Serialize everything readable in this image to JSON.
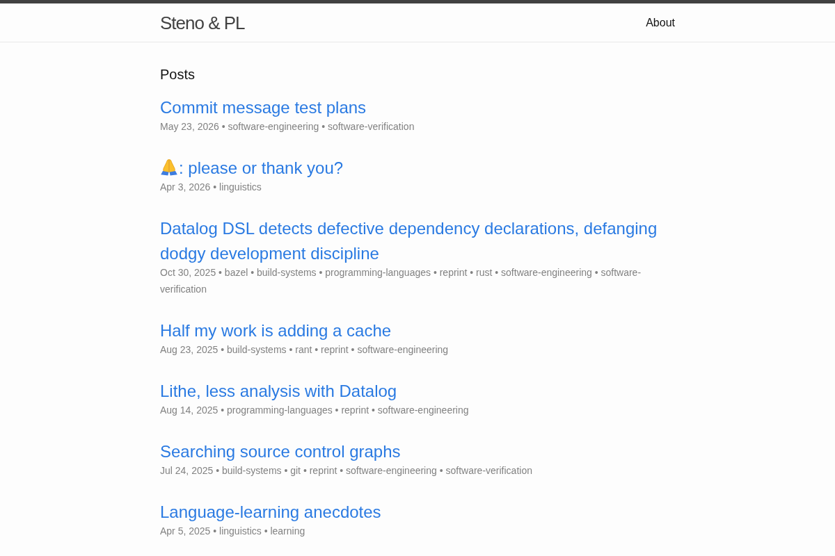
{
  "site": {
    "title": "Steno & PL",
    "nav": [
      {
        "label": "About"
      }
    ]
  },
  "heading": "Posts",
  "posts": [
    {
      "kind": "plain",
      "title": "Commit message test plans",
      "meta": "May 23, 2026 • software-engineering • software-verification"
    },
    {
      "kind": "with-icon",
      "title": ": please or thank you?",
      "meta": "Apr 3, 2026 • linguistics"
    },
    {
      "kind": "plain",
      "title": "Datalog DSL detects defective dependency declarations, defanging dodgy development discipline",
      "meta": "Oct 30, 2025 • bazel • build-systems • programming-languages • reprint • rust • software-engineering • software-verification"
    },
    {
      "kind": "plain",
      "title": "Half my work is adding a cache",
      "meta": "Aug 23, 2025 • build-systems • rant • reprint • software-engineering"
    },
    {
      "kind": "plain",
      "title": "Lithe, less analysis with Datalog",
      "meta": "Aug 14, 2025 • programming-languages • reprint • software-engineering"
    },
    {
      "kind": "plain",
      "title": "Searching source control graphs",
      "meta": "Jul 24, 2025 • build-systems • git • reprint • software-engineering • software-verification"
    },
    {
      "kind": "plain",
      "title": "Language-learning anecdotes",
      "meta": "Apr 5, 2025 • linguistics • learning"
    }
  ]
}
